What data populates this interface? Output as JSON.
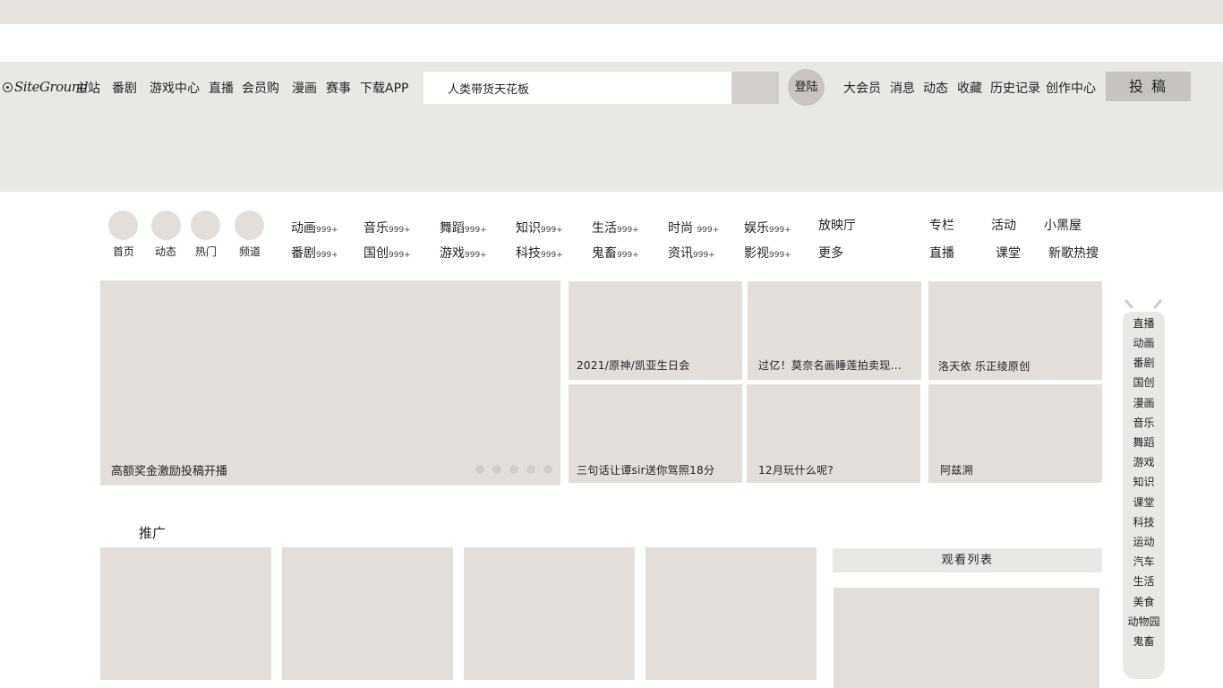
{
  "logo": {
    "text": "SiteGround"
  },
  "nav": {
    "left": [
      "主站",
      "番剧",
      "游戏中心",
      "直播",
      "会员购",
      "漫画",
      "赛事",
      "下载APP"
    ],
    "right": [
      "大会员",
      "消息",
      "动态",
      "收藏",
      "历史记录",
      "创作中心"
    ]
  },
  "search": {
    "value": "人类带货天花板"
  },
  "login_label": "登陆",
  "upload_label": "投 稿",
  "quick": [
    "首页",
    "动态",
    "热门",
    "频道"
  ],
  "categories": {
    "row1": [
      {
        "name": "动画",
        "count": "999+"
      },
      {
        "name": "音乐",
        "count": "999+"
      },
      {
        "name": "舞蹈",
        "count": "999+"
      },
      {
        "name": "知识",
        "count": "999+"
      },
      {
        "name": "生活",
        "count": "999+"
      },
      {
        "name": "时尚",
        "count": "999+"
      },
      {
        "name": "娱乐",
        "count": "999+"
      }
    ],
    "row2": [
      {
        "name": "番剧",
        "count": "999+"
      },
      {
        "name": "国创",
        "count": "999+"
      },
      {
        "name": "游戏",
        "count": "999+"
      },
      {
        "name": "科技",
        "count": "999+"
      },
      {
        "name": "鬼畜",
        "count": "999+"
      },
      {
        "name": "资讯",
        "count": "999+"
      },
      {
        "name": "影视",
        "count": "999+"
      }
    ],
    "extra1": [
      "放映厅",
      "专栏",
      "活动",
      "小黑屋"
    ],
    "extra2": [
      "更多",
      "直播",
      "课堂",
      "新歌热搜"
    ]
  },
  "banner": {
    "title": "高额奖金激励投稿开播",
    "dot_count": 5
  },
  "tiles": [
    "2021/原神/凯亚生日会",
    "过亿！莫奈名画睡莲拍卖现...",
    "洛天依 乐正绫原创",
    "三句话让谭sir送你驾照18分",
    "12月玩什么呢?",
    "阿兹溯"
  ],
  "promo": {
    "title": "推广"
  },
  "watchlist": {
    "title": "观看列表"
  },
  "sidebar": [
    "直播",
    "动画",
    "番剧",
    "国创",
    "漫画",
    "音乐",
    "舞蹈",
    "游戏",
    "知识",
    "课堂",
    "科技",
    "运动",
    "汽车",
    "生活",
    "美食",
    "动物园",
    "鬼畜"
  ],
  "colors": {
    "header_bg": "#e9e8e5",
    "tile_bg": "#e3deda",
    "top_band": "#e7e3df"
  }
}
